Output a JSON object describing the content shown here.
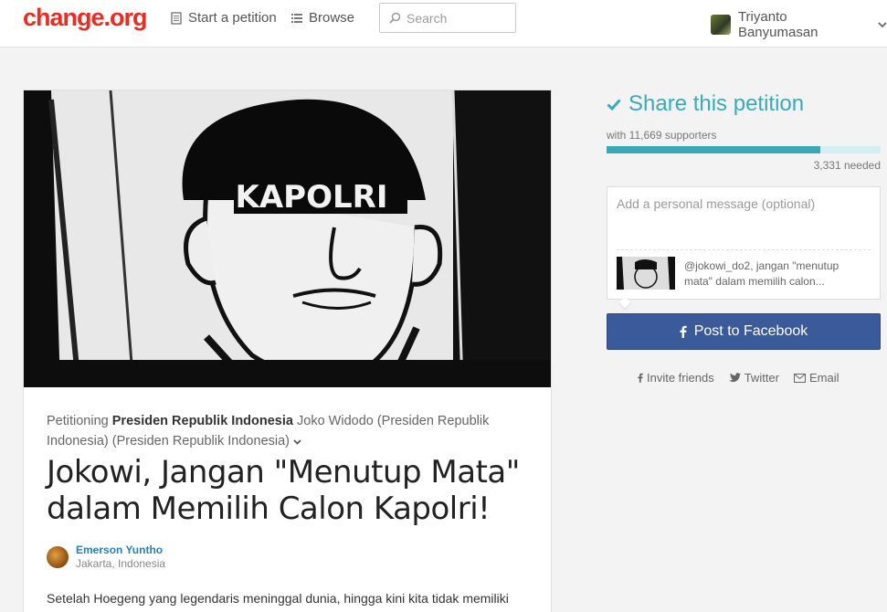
{
  "header": {
    "logo": "change.org",
    "nav": {
      "start": "Start a petition",
      "browse": "Browse"
    },
    "search": {
      "placeholder": "Search"
    },
    "user": {
      "name": "Triyanto Banyumasan"
    }
  },
  "petition": {
    "hero_caption": "KAPOLRI",
    "petitioning_prefix": "Petitioning",
    "target_bold": "Presiden Republik Indonesia",
    "target_rest": "Joko Widodo (Presiden Republik Indonesia) (Presiden Republik Indonesia)",
    "title": "Jokowi, Jangan \"Menutup Mata\" dalam Memilih Calon Kapolri!",
    "author": {
      "name": "Emerson Yuntho",
      "location": "Jakarta, Indonesia"
    },
    "body_start": "Setelah Hoegeng yang legendaris meninggal dunia, hingga kini kita tidak memiliki"
  },
  "share": {
    "heading": "Share this petition",
    "supporters_text": "with 11,669 supporters",
    "progress_fraction": 0.78,
    "needed_text": "3,331 needed",
    "message_placeholder": "Add a personal message (optional)",
    "preview_text": "@jokowi_do2, jangan \"menutup mata\" dalam memilih calon...",
    "facebook_label": "Post to Facebook",
    "links": {
      "invite": "Invite friends",
      "twitter": "Twitter",
      "email": "Email"
    }
  },
  "colors": {
    "brand_red": "#ec2c22",
    "teal": "#3aaabb",
    "facebook": "#3b5a99",
    "link_blue": "#2a7fb5"
  },
  "icons": [
    "document-icon",
    "list-icon",
    "search-icon",
    "chevron-down-icon",
    "check-icon",
    "facebook-icon",
    "twitter-icon",
    "email-icon"
  ]
}
